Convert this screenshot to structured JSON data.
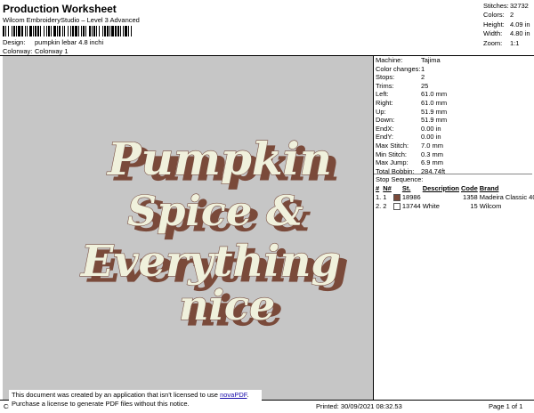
{
  "header": {
    "title": "Production Worksheet",
    "subtitle": "Wilcom EmbroideryStudio – Level 3 Advanced",
    "design_label": "Design:",
    "design_value": "pumpkin lebar 4.8 inchi",
    "colorway_label": "Colorway:",
    "colorway_value": "Colorway 1"
  },
  "summary": [
    {
      "label": "Stitches:",
      "value": "32732"
    },
    {
      "label": "Colors:",
      "value": "2"
    },
    {
      "label": "Height:",
      "value": "4.09 in"
    },
    {
      "label": "Width:",
      "value": "4.80 in"
    },
    {
      "label": "Zoom:",
      "value": "1:1"
    }
  ],
  "design_text": [
    "Pumpkin",
    "Spice &",
    "Everything",
    "nice"
  ],
  "details": [
    {
      "label": "Machine:",
      "value": "Tajima"
    },
    {
      "label": "Color changes:",
      "value": "1"
    },
    {
      "label": "Stops:",
      "value": "2"
    },
    {
      "label": "Trims:",
      "value": "25"
    },
    {
      "label": "Left:",
      "value": "61.0 mm"
    },
    {
      "label": "Right:",
      "value": "61.0 mm"
    },
    {
      "label": "Up:",
      "value": "51.9 mm"
    },
    {
      "label": "Down:",
      "value": "51.9 mm"
    },
    {
      "label": "EndX:",
      "value": "0.00 in"
    },
    {
      "label": "EndY:",
      "value": "0.00 in"
    },
    {
      "label": "Max Stitch:",
      "value": "7.0 mm"
    },
    {
      "label": "Min Stitch:",
      "value": "0.3 mm"
    },
    {
      "label": "Max Jump:",
      "value": "6.9 mm"
    },
    {
      "label": "Total Bobbin:",
      "value": "284.74ft"
    }
  ],
  "stop_sequence": {
    "title": "Stop Sequence:",
    "columns": [
      "#",
      "N#",
      "St.",
      "Description",
      "Code",
      "Brand"
    ],
    "rows": [
      {
        "idx": "1.",
        "num": "1",
        "color": "#7a4a3a",
        "st": "18986",
        "desc": "",
        "code": "1358",
        "brand": "Madeira Classic 40"
      },
      {
        "idx": "2.",
        "num": "2",
        "color": "#ffffff",
        "st": "13744",
        "desc": "White",
        "code": "15",
        "brand": "Wilcom"
      }
    ]
  },
  "footer": {
    "left": "Cr",
    "printed": "Printed: 30/09/2021 08:32.53",
    "page": "Page 1 of 1"
  },
  "notice": {
    "line1": "This document was created by an application that isn't licensed to use ",
    "link": "novaPDF",
    "line1_end": ".",
    "line2": "Purchase a license to generate PDF files without this notice."
  },
  "colors": {
    "thread1": "#7a4a3a",
    "thread2": "#f0f1dc",
    "canvas": "#c6c6c6"
  }
}
